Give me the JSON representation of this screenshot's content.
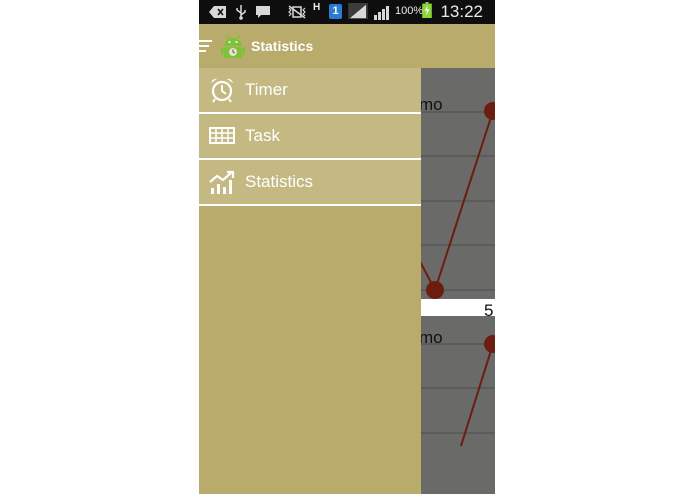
{
  "status_bar": {
    "time": "13:22",
    "battery_percent": "100%",
    "sim_badge": "1",
    "network_type": "H"
  },
  "action_bar": {
    "title": "Statistics"
  },
  "drawer": {
    "items": [
      {
        "label": "Timer",
        "icon": "alarm-clock-icon"
      },
      {
        "label": "Task",
        "icon": "table-grid-icon"
      },
      {
        "label": "Statistics",
        "icon": "chart-trend-icon"
      }
    ]
  },
  "chart": {
    "label_top": "mo",
    "label_bottom": "mo",
    "tick_label": "5"
  },
  "colors": {
    "accent": "#b8ab6b",
    "drawer_item": "#c4b983",
    "chart_bg": "#6a6a68",
    "line": "#6b1d10"
  }
}
